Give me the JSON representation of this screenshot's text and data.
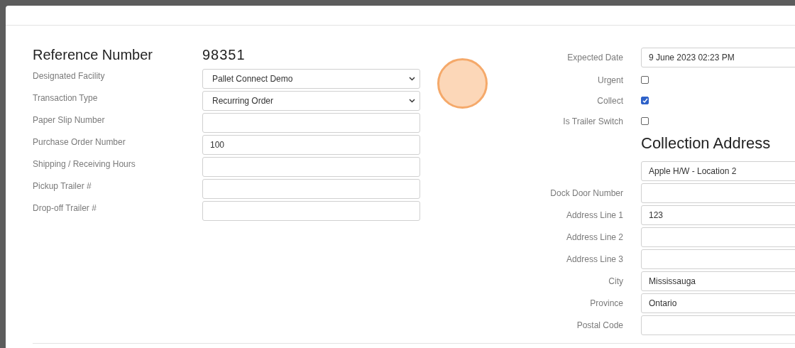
{
  "reference": {
    "label": "Reference Number",
    "value": "98351"
  },
  "left_fields": [
    {
      "kind": "select",
      "label": "Designated Facility",
      "value": "Pallet Connect Demo"
    },
    {
      "kind": "select",
      "label": "Transaction Type",
      "value": "Recurring Order"
    },
    {
      "kind": "text",
      "label": "Paper Slip Number"
    },
    {
      "kind": "text",
      "label": "Purchase Order Number",
      "value": "100"
    },
    {
      "kind": "text",
      "label": "Shipping / Receiving Hours"
    },
    {
      "kind": "text",
      "label": "Pickup Trailer #"
    },
    {
      "kind": "text",
      "label": "Drop-off Trailer #"
    }
  ],
  "right_fields": [
    {
      "kind": "text",
      "label": "Expected Date",
      "value": "9 June 2023 02:23 PM"
    },
    {
      "kind": "checkbox",
      "label": "Urgent",
      "checked": false
    },
    {
      "kind": "checkbox",
      "label": "Collect",
      "checked": true
    },
    {
      "kind": "checkbox",
      "label": "Is Trailer Switch",
      "checked": false
    },
    {
      "kind": "heading",
      "text": "Collection Address"
    },
    {
      "kind": "text",
      "value": "Apple H/W - Location 2"
    },
    {
      "kind": "text",
      "label": "Dock Door Number"
    },
    {
      "kind": "text",
      "label": "Address Line 1",
      "value": "123"
    },
    {
      "kind": "text",
      "label": "Address Line 2"
    },
    {
      "kind": "text",
      "label": "Address Line 3"
    },
    {
      "kind": "text",
      "label": "City",
      "value": "Mississauga"
    },
    {
      "kind": "text",
      "label": "Province",
      "value": "Ontario"
    },
    {
      "kind": "text",
      "label": "Postal Code"
    }
  ]
}
